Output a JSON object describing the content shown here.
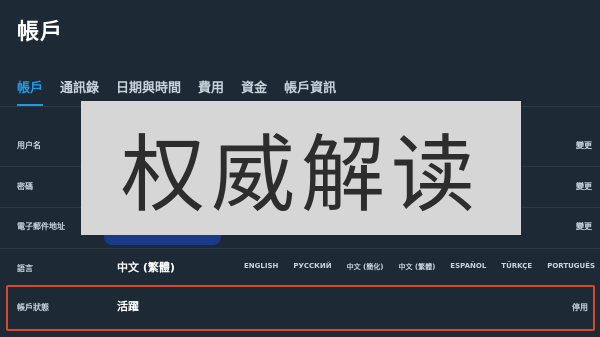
{
  "header": {
    "title": "帳戶"
  },
  "tabs": [
    {
      "label": "帳戶"
    },
    {
      "label": "通訊錄"
    },
    {
      "label": "日期與時間"
    },
    {
      "label": "費用"
    },
    {
      "label": "資金"
    },
    {
      "label": "帳戶資訊"
    }
  ],
  "fields": {
    "username": {
      "label": "用户名",
      "action": "變更"
    },
    "password": {
      "label": "密碼",
      "action": "變更"
    },
    "email": {
      "label": "電子郵件地址",
      "action": "變更"
    },
    "language": {
      "label": "語言",
      "value": "中文 (繁體)",
      "options": [
        "ENGLISH",
        "РУССКИЙ",
        "中文 (簡化)",
        "中文 (繁體)",
        "ESPAÑOL",
        "TÜRKÇE",
        "PORTUGUÊS"
      ]
    },
    "status": {
      "label": "帳戶狀態",
      "value": "活躍",
      "action": "停用"
    }
  },
  "overlay": {
    "text": "权威解读"
  },
  "colors": {
    "accent": "#1e9be6",
    "highlight_border": "#d9482b",
    "background": "#1d2a36"
  }
}
